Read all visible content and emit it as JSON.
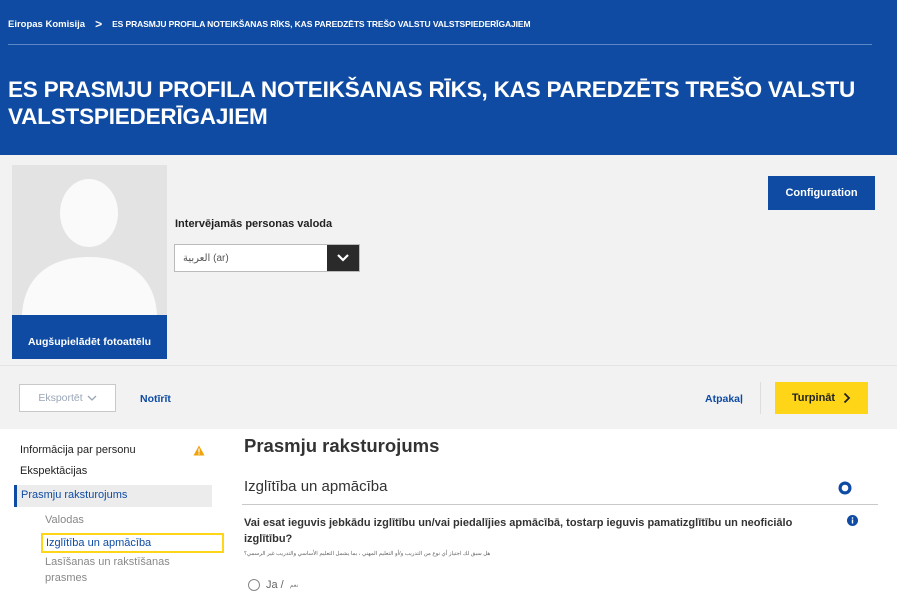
{
  "header": {
    "breadcrumb_root": "Eiropas Komisija",
    "breadcrumb_separator": ">",
    "breadcrumb_current": "ES PRASMJU PROFILA NOTEIKŠANAS RĪKS, KAS PAREDZĒTS TREŠO VALSTU VALSTSPIEDERĪGAJIEM",
    "title": "ES PRASMJU PROFILA NOTEIKŠANAS RĪKS, KAS PAREDZĒTS TREŠO VALSTU VALSTSPIEDERĪGAJIEM"
  },
  "profile": {
    "upload_label": "Augšupielādēt fotoattēlu",
    "language_label": "Intervējamās personas valoda",
    "language_value": "العربية (ar)",
    "configuration_label": "Configuration"
  },
  "toolbar": {
    "export_label": "Eksportēt",
    "clear_label": "Notīrīt",
    "back_label": "Atpakaļ",
    "next_label": "Turpināt"
  },
  "sidebar": {
    "items": [
      {
        "label": "Informācija par personu"
      },
      {
        "label": "Ekspektācijas"
      },
      {
        "label": "Prasmju raksturojums"
      }
    ],
    "subitems": [
      {
        "label": "Valodas"
      },
      {
        "label": "Izglītība un apmācība"
      },
      {
        "label": "Lasīšanas un rakstīšanas"
      },
      {
        "label": "prasmes"
      }
    ]
  },
  "main": {
    "title": "Prasmju raksturojums",
    "section_title": "Izglītība un apmācība",
    "question": "Vai esat ieguvis jebkādu izglītību un/vai piedalījies apmācībā, tostarp ieguvis pamatizglītību un neoficiālo izglītību?",
    "question_ar": "هل سبق لك اجتياز أي نوع من التدريب و/أو التعليم المهني ، بما يشمل التعليم الأساسي والتدريب غير الرسمي؟",
    "option_yes": "Ja /",
    "option_yes_ar": "نعم"
  },
  "colors": {
    "primary": "#0f4ba3",
    "accent": "#ffd617",
    "warning": "#f0a30a"
  }
}
